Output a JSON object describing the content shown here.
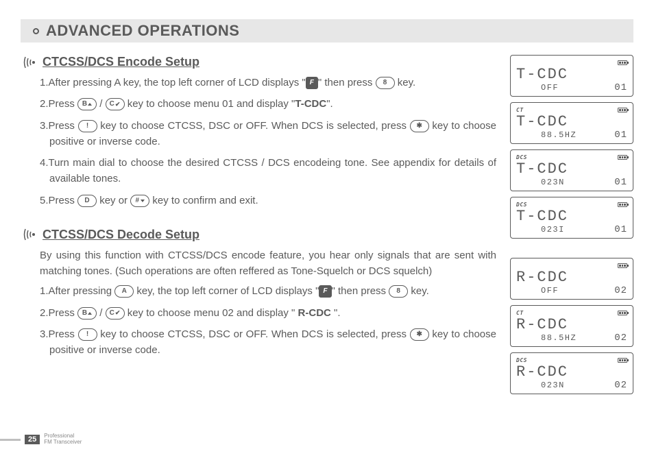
{
  "header": {
    "title": "ADVANCED OPERATIONS"
  },
  "section1": {
    "title": "CTCSS/DCS Encode Setup",
    "steps": {
      "s1a": "1.After pressing A key, the top left corner of LCD displays \"",
      "s1b": "\" then press ",
      "s1c": " key.",
      "s2a": "2.Press ",
      "s2b": " / ",
      "s2c": " key to choose menu 01 and display \"",
      "s2d": "T-CDC",
      "s2e": "\".",
      "s3a": "3.Press ",
      "s3b": " key to choose CTCSS, DSC or OFF. When DCS is  selected, press ",
      "s3c": " key to choose positive or inverse code.",
      "s4": "4.Turn main dial to choose the desired CTCSS / DCS encodeing tone. See appendix for details of available tones.",
      "s5a": "5.Press ",
      "s5b": " key or ",
      "s5c": " key to confirm and exit."
    }
  },
  "section2": {
    "title": "CTCSS/DCS Decode Setup",
    "intro": "By using this function with CTCSS/DCS encode feature, you hear only signals that are sent with matching tones. (Such operations are often reffered as Tone-Squelch or DCS squelch)",
    "steps": {
      "s1a": "1.After pressing ",
      "s1b": " key, the top left corner of LCD displays \"",
      "s1c": "\" then press ",
      "s1d": " key.",
      "s2a": "2.Press ",
      "s2b": " / ",
      "s2c": "  key to choose menu 02 and display \" ",
      "s2d": "R-CDC",
      "s2e": " \".",
      "s3a": "3.Press ",
      "s3b": " key to choose CTCSS, DSC or OFF. When DCS is  selected, press ",
      "s3c": " key to choose positive or inverse code."
    }
  },
  "keys": {
    "F": "F",
    "8": "8",
    "B": "B",
    "C": "C",
    "exclam": "!",
    "star": "✱",
    "D": "D",
    "hash": "#",
    "A": "A"
  },
  "lcds": [
    {
      "indicator": "",
      "main": "T-CDC",
      "sub": "OFF",
      "num": "01"
    },
    {
      "indicator": "CT",
      "main": "T-CDC",
      "sub": "88.5HZ",
      "num": "01"
    },
    {
      "indicator": "DCS",
      "main": "T-CDC",
      "sub": "023N",
      "num": "01"
    },
    {
      "indicator": "DCS",
      "main": "T-CDC",
      "sub": "023I",
      "num": "01"
    },
    {
      "indicator": "",
      "main": "R-CDC",
      "sub": "OFF",
      "num": "02"
    },
    {
      "indicator": "CT",
      "main": "R-CDC",
      "sub": "88.5HZ",
      "num": "02"
    },
    {
      "indicator": "DCS",
      "main": "R-CDC",
      "sub": "023N",
      "num": "02"
    }
  ],
  "footer": {
    "page": "25",
    "line1": "Professional",
    "line2": "FM Transceiver"
  }
}
